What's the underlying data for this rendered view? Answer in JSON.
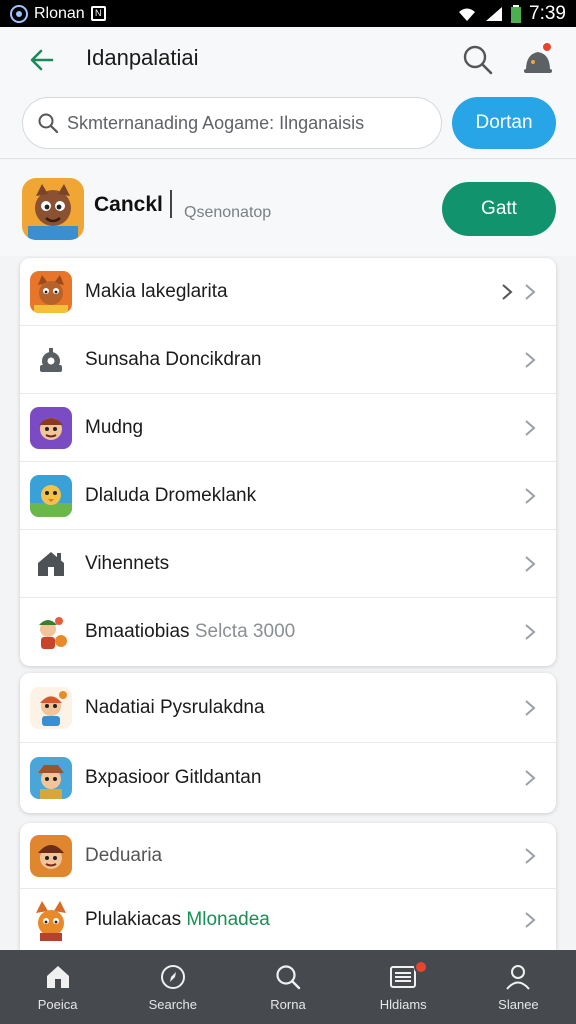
{
  "status_bar": {
    "app_label": "Rlonan",
    "time": "7:39"
  },
  "app_bar": {
    "title": "Idanpalatiai",
    "back_icon": "back-arrow-icon",
    "search_icon": "search-icon",
    "notification_icon": "notification-icon"
  },
  "search": {
    "placeholder": "Skmternanading Aogame: Ilnganaisis",
    "button_label": "Dortan"
  },
  "featured": {
    "name": "Canckl",
    "subtitle": "Qsenonatop",
    "button_label": "Gatt"
  },
  "list_group_1": [
    {
      "label": "Makia lakeglarita",
      "icon": "game-fox-icon"
    },
    {
      "label": "Sunsaha Doncikdran",
      "icon": "settings-cog-icon"
    },
    {
      "label": "Mudng",
      "icon": "game-purple-icon"
    },
    {
      "label": "Dlaluda Dromeklank",
      "icon": "game-bird-icon"
    },
    {
      "label": "Vihennets",
      "icon": "home-icon"
    },
    {
      "label": "Bmaatiobias",
      "label_suffix": "Selcta 3000",
      "icon": "game-character-icon"
    }
  ],
  "list_group_2": [
    {
      "label": "Nadatiai Pysrulakdna",
      "icon": "game-character-icon"
    },
    {
      "label": "Bxpasioor Gitldantan",
      "icon": "game-farmer-icon"
    }
  ],
  "list_group_3": [
    {
      "label": "Deduaria",
      "icon": "game-pirate-icon"
    },
    {
      "label": "Plulakiacas",
      "label_suffix": "Mlonadea",
      "icon": "game-fox-icon"
    }
  ],
  "bottom_nav": [
    {
      "label": "Poeica",
      "icon": "home-icon"
    },
    {
      "label": "Searche",
      "icon": "compass-icon"
    },
    {
      "label": "Rorna",
      "icon": "search-icon"
    },
    {
      "label": "Hldiams",
      "icon": "list-icon",
      "badge": true
    },
    {
      "label": "Slanee",
      "icon": "profile-icon"
    }
  ],
  "colors": {
    "accent_green": "#11946d",
    "accent_blue": "#27a5e6",
    "back_arrow": "#1a8a5a",
    "nav_bg": "#46494d",
    "badge_red": "#e7452f"
  }
}
